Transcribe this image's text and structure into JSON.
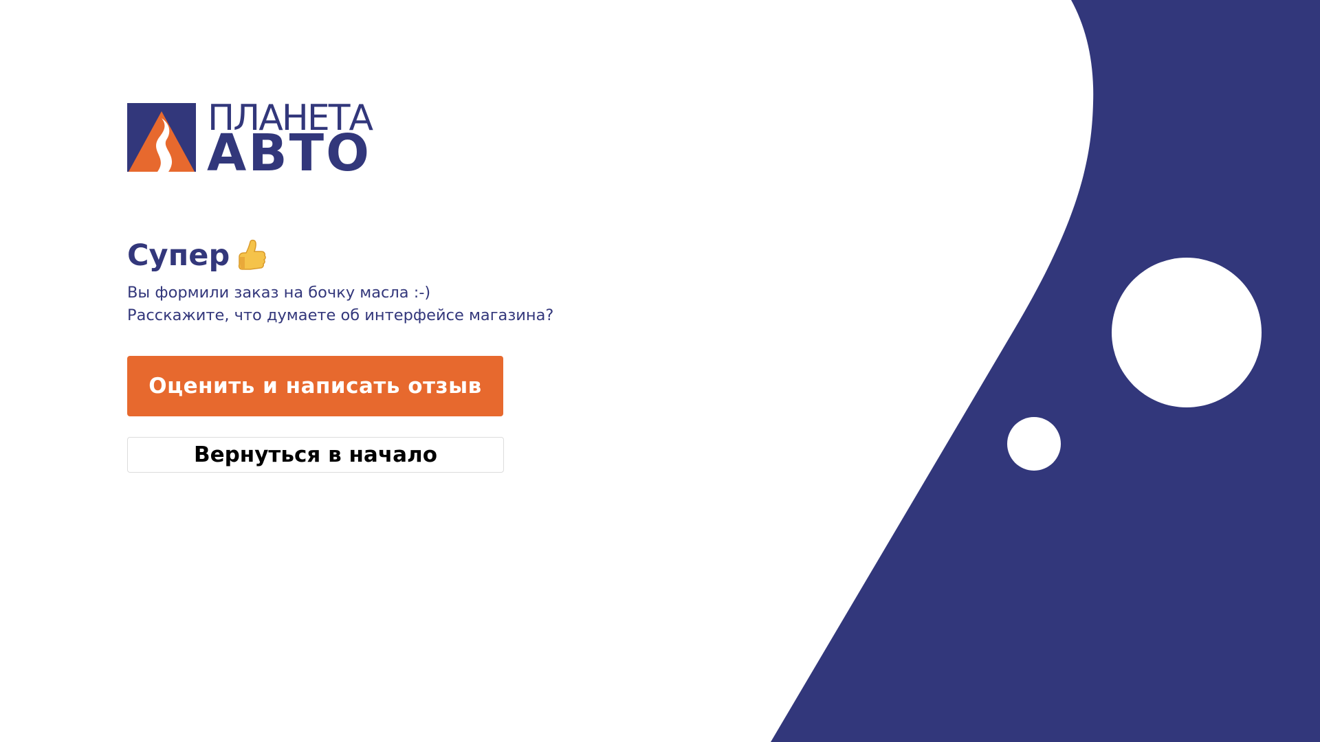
{
  "brand": {
    "name_line1": "ПЛАНЕТА",
    "name_line2": "АВТО",
    "primary_color": "#32377b",
    "accent_color": "#e7692e"
  },
  "icons": {
    "logo_mark": "road-mountain-logo-icon",
    "heading_emoji": "thumbs-up-icon"
  },
  "content": {
    "heading": "Супер",
    "message_line1": "Вы формили заказ на бочку масла :-)",
    "message_line2": "Расскажите, что думаете об интерфейсе магазина?"
  },
  "actions": {
    "rate_label": "Оценить и написать отзыв",
    "back_label": "Вернуться в начало"
  },
  "colors": {
    "background": "#ffffff",
    "shape": "#32377b",
    "button_primary": "#e7692e",
    "button_primary_text": "#ffffff",
    "button_secondary_text": "#000000"
  }
}
